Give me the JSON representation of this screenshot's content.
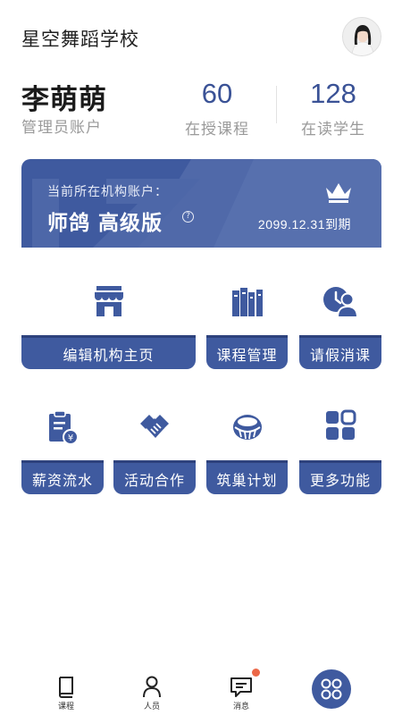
{
  "header": {
    "school_name": "星空舞蹈学校"
  },
  "user": {
    "name": "李萌萌",
    "role": "管理员账户"
  },
  "stats": [
    {
      "value": "60",
      "label": "在授课程"
    },
    {
      "value": "128",
      "label": "在读学生"
    }
  ],
  "banner": {
    "caption": "当前所在机构账户：",
    "title": "师鸽 高级版",
    "help_icon": "question-circle-icon",
    "expiry": "2099.12.31到期",
    "crown_icon": "crown-icon"
  },
  "grid": [
    {
      "label": "编辑机构主页",
      "icon": "storefront-icon"
    },
    {
      "label": "课程管理",
      "icon": "books-icon"
    },
    {
      "label": "请假消课",
      "icon": "person-clock-icon"
    },
    {
      "label": "薪资流水",
      "icon": "salary-clipboard-icon"
    },
    {
      "label": "活动合作",
      "icon": "handshake-icon"
    },
    {
      "label": "筑巢计划",
      "icon": "nest-icon"
    },
    {
      "label": "更多功能",
      "icon": "grid-icon"
    }
  ],
  "tabs": [
    {
      "label": "课程",
      "icon": "book-icon"
    },
    {
      "label": "人员",
      "icon": "person-icon"
    },
    {
      "label": "消息",
      "icon": "message-icon"
    }
  ],
  "fab": {
    "icon": "apps-circle-icon"
  },
  "colors": {
    "primary": "#3f5a9f",
    "primary_dark": "#2e427d",
    "number": "#3a5296",
    "muted": "#9a9a9a",
    "badge": "#ec6848"
  }
}
